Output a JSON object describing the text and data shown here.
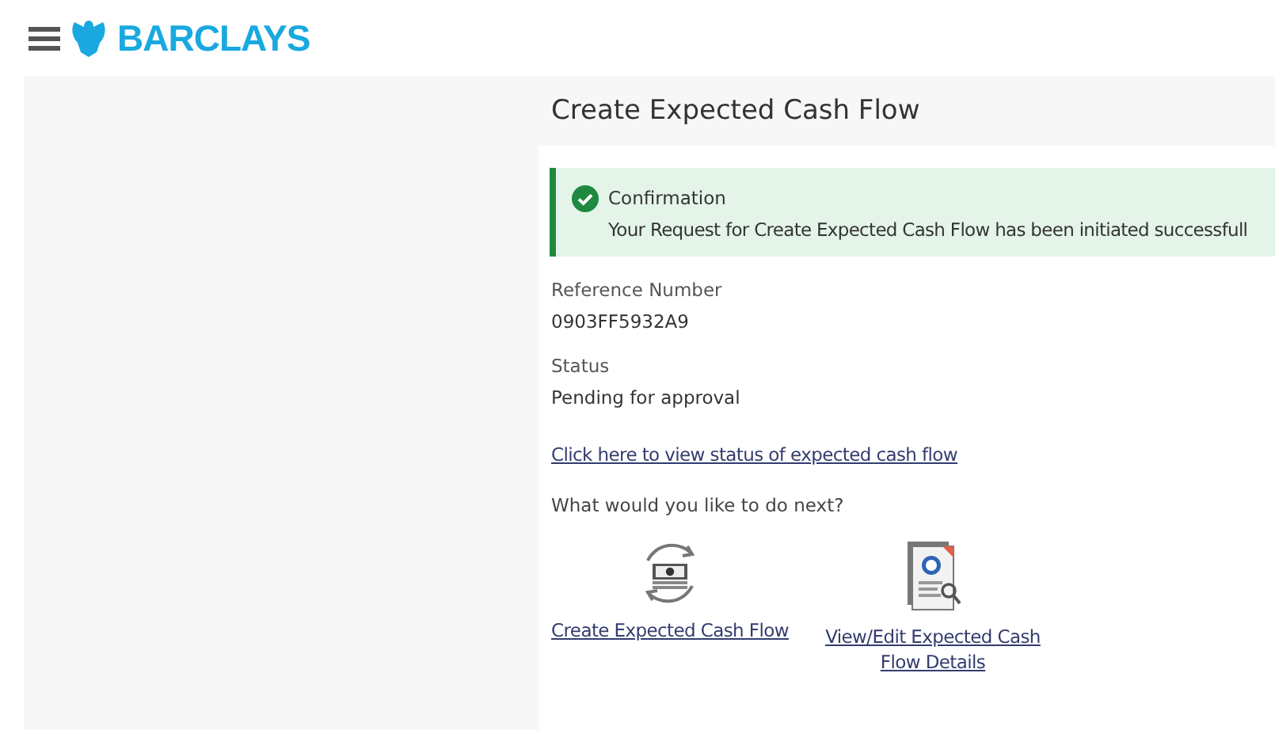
{
  "header": {
    "brand": "BARCLAYS"
  },
  "page": {
    "title": "Create Expected Cash Flow"
  },
  "confirmation": {
    "title": "Confirmation",
    "message": "Your Request for Create Expected Cash Flow has been initiated successfull"
  },
  "fields": [
    {
      "label": "Reference Number",
      "value": "0903FF5932A9"
    },
    {
      "label": "Status",
      "value": "Pending for approval"
    }
  ],
  "status_link": "Click here to view status of expected cash flow",
  "next_prompt": "What would you like to do next?",
  "actions": [
    {
      "kind": "create",
      "label": "Create Expected Cash Flow"
    },
    {
      "kind": "view",
      "label": "View/Edit Expected Cash Flow Details"
    }
  ]
}
